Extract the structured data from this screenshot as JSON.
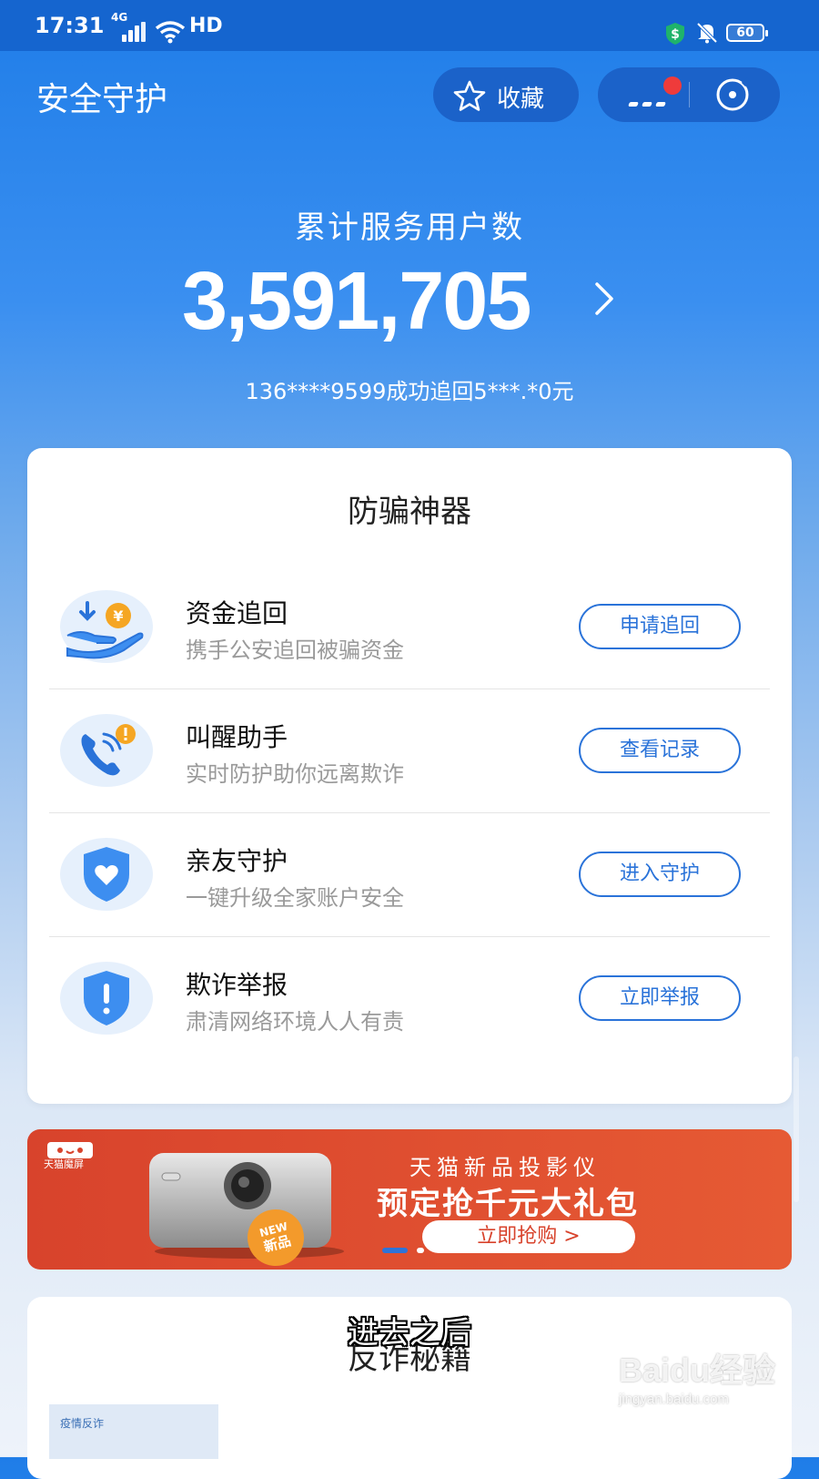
{
  "status_bar": {
    "time": "17:31",
    "network": "4G",
    "hd": "HD",
    "battery": "60"
  },
  "header": {
    "title": "安全守护",
    "favorite_label": "收藏"
  },
  "hero": {
    "label": "累计服务用户数",
    "count": "3,591,705",
    "ticker": "136****9599成功追回5***.*0元"
  },
  "tools": {
    "title": "防骗神器",
    "items": [
      {
        "title": "资金追回",
        "subtitle": "携手公安追回被骗资金",
        "button": "申请追回",
        "icon": "money-hand-icon"
      },
      {
        "title": "叫醒助手",
        "subtitle": "实时防护助你远离欺诈",
        "button": "查看记录",
        "icon": "phone-alert-icon"
      },
      {
        "title": "亲友守护",
        "subtitle": "一键升级全家账户安全",
        "button": "进入守护",
        "icon": "heart-shield-icon"
      },
      {
        "title": "欺诈举报",
        "subtitle": "肃清网络环境人人有责",
        "button": "立即举报",
        "icon": "alert-shield-icon"
      }
    ]
  },
  "banner": {
    "brand": "天猫魔屏",
    "line1": "天猫新品投影仪",
    "line2": "预定抢千元大礼包",
    "cta": "立即抢购 >",
    "badge_top": "NEW",
    "badge_bottom": "新品",
    "active_page": 1,
    "page_count": 2
  },
  "secrets": {
    "title": "反诈秘籍",
    "thumb_label": "疫情反诈"
  },
  "overlay_caption": "进去之后",
  "watermark": {
    "brand": "Baidu经验",
    "url": "jingyan.baidu.com"
  },
  "colors": {
    "primary": "#1f7de8",
    "accent_button": "#2a73d9",
    "banner_red": "#d8432c"
  }
}
